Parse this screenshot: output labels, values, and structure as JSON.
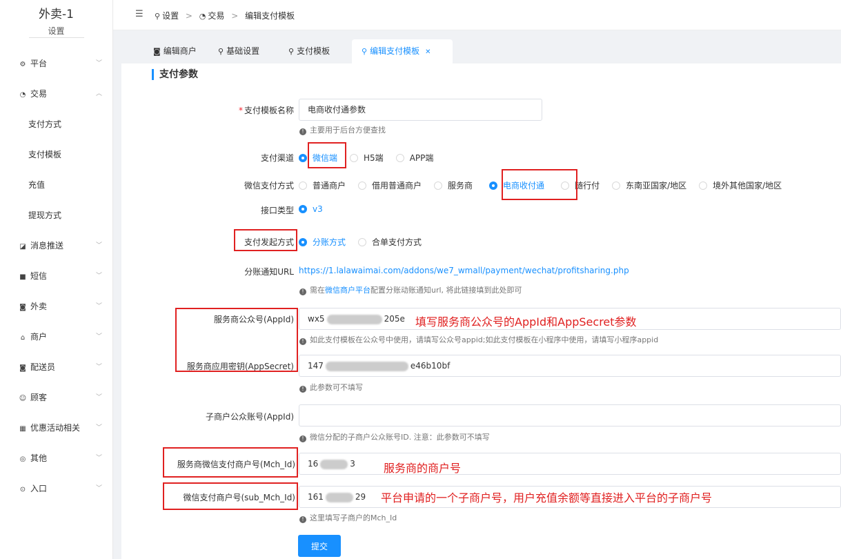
{
  "brand": {
    "title": "外卖-1",
    "subtitle": "设置"
  },
  "sidebar": {
    "items": [
      {
        "label": "平台",
        "icon": "gear-icon"
      },
      {
        "label": "交易",
        "icon": "trade-icon"
      },
      {
        "label": "支付方式"
      },
      {
        "label": "支付模板"
      },
      {
        "label": "充值"
      },
      {
        "label": "提现方式"
      },
      {
        "label": "消息推送",
        "icon": "message-icon"
      },
      {
        "label": "短信",
        "icon": "sms-icon"
      },
      {
        "label": "外卖",
        "icon": "takeout-icon"
      },
      {
        "label": "商户",
        "icon": "store-icon"
      },
      {
        "label": "配送员",
        "icon": "courier-icon"
      },
      {
        "label": "顾客",
        "icon": "customer-icon"
      },
      {
        "label": "优惠活动相关",
        "icon": "gift-icon"
      },
      {
        "label": "其他",
        "icon": "other-icon"
      },
      {
        "label": "入口",
        "icon": "entry-icon"
      }
    ]
  },
  "breadcrumb": {
    "items": [
      "设置",
      "交易",
      "编辑支付模板"
    ]
  },
  "tabs": [
    {
      "label": "编辑商户"
    },
    {
      "label": "基础设置"
    },
    {
      "label": "支付模板"
    },
    {
      "label": "编辑支付模板",
      "active": true
    }
  ],
  "section": {
    "title": "支付参数"
  },
  "form": {
    "template_name": {
      "label": "支付模板名称",
      "value": "电商收付通参数",
      "hint": "主要用于后台方便查找"
    },
    "channel": {
      "label": "支付渠道",
      "options": [
        "微信端",
        "H5端",
        "APP端"
      ],
      "selected": "微信端"
    },
    "wechat_method": {
      "label": "微信支付方式",
      "options": [
        "普通商户",
        "借用普通商户",
        "服务商",
        "电商收付通",
        "随行付",
        "东南亚国家/地区",
        "境外其他国家/地区"
      ],
      "selected": "电商收付通"
    },
    "api_type": {
      "label": "接口类型",
      "options": [
        "v3"
      ],
      "selected": "v3"
    },
    "initiate_method": {
      "label": "支付发起方式",
      "options": [
        "分账方式",
        "合单支付方式"
      ],
      "selected": "分账方式"
    },
    "profit_url": {
      "label": "分账通知URL",
      "value": "https://1.lalawaimai.com/addons/we7_wmall/payment/wechat/profitsharing.php",
      "hint_pre": "需在",
      "hint_link": "微信商户平台",
      "hint_post": "配置分账动账通知url, 将此链接填到此处即可"
    },
    "sp_appid": {
      "label": "服务商公众号(AppId)",
      "value_start": "wx5",
      "value_end": "205e",
      "hint": "如此支付模板在公众号中使用，请填写公众号appid;如此支付模板在小程序中使用，请填写小程序appid"
    },
    "sp_secret": {
      "label": "服务商应用密钥(AppSecret)",
      "value_start": "147",
      "value_end": "e46b10bf",
      "hint": "此参数可不填写"
    },
    "sub_appid": {
      "label": "子商户公众账号(AppId)",
      "value": "",
      "hint": "微信分配的子商户公众账号ID. 注意：此参数可不填写"
    },
    "sp_mchid": {
      "label": "服务商微信支付商户号(Mch_Id)",
      "value_start": "16",
      "value_end": "3"
    },
    "sub_mchid": {
      "label": "微信支付商户号(sub_Mch_Id)",
      "value_start": "161",
      "value_end": "29",
      "hint": "这里填写子商户的Mch_Id"
    },
    "submit_label": "提交"
  },
  "annotations": {
    "appid_note": "填写服务商公众号的AppId和AppSecret参数",
    "mchid_note": "服务商的商户号",
    "sub_mchid_note": "平台申请的一个子商户号，用户充值余额等直接进入平台的子商户号"
  },
  "colors": {
    "accent": "#1890ff",
    "annotation": "#e02020"
  }
}
